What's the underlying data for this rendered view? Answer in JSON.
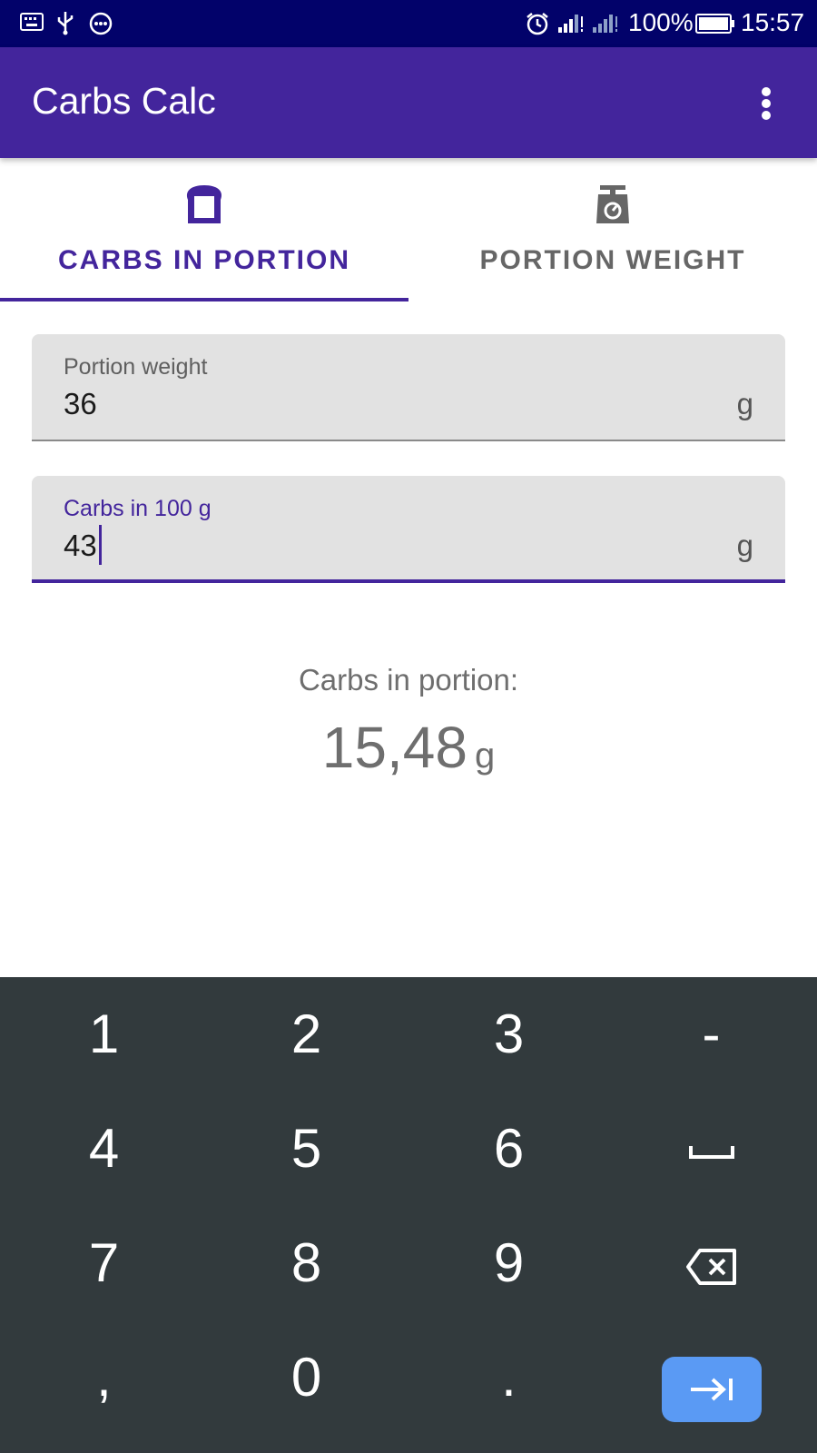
{
  "status_bar": {
    "battery_text": "100%",
    "time": "15:57",
    "left_icons": [
      "keyboard-icon",
      "usb-icon",
      "more-circle-icon"
    ],
    "right_icons": [
      "alarm-icon",
      "signal-icon",
      "signal-icon",
      "battery-icon"
    ]
  },
  "app_bar": {
    "title": "Carbs Calc",
    "menu_icon": "more-vert-icon"
  },
  "tabs": [
    {
      "label": "CARBS IN PORTION",
      "icon": "bread-icon",
      "selected": true
    },
    {
      "label": "PORTION WEIGHT",
      "icon": "scale-icon",
      "selected": false
    }
  ],
  "fields": {
    "portion_weight": {
      "label": "Portion weight",
      "value": "36",
      "unit": "g"
    },
    "carbs_in_100g": {
      "label": "Carbs in 100 g",
      "value": "43",
      "unit": "g",
      "focused": true
    }
  },
  "result": {
    "label": "Carbs in portion:",
    "value": "15,48",
    "unit": "g"
  },
  "keyboard": {
    "rows": [
      [
        "1",
        "2",
        "3",
        "-"
      ],
      [
        "4",
        "5",
        "6",
        "space-icon"
      ],
      [
        "7",
        "8",
        "9",
        "backspace-icon"
      ],
      [
        ",",
        "0",
        ".",
        "tab-enter-icon"
      ]
    ]
  },
  "colors": {
    "status_bar": "#02026a",
    "primary": "#43259c",
    "tab_inactive": "#666666",
    "field_bg": "#e2e2e2",
    "keyboard_bg": "#323a3d",
    "enter_key": "#5a9af4"
  }
}
